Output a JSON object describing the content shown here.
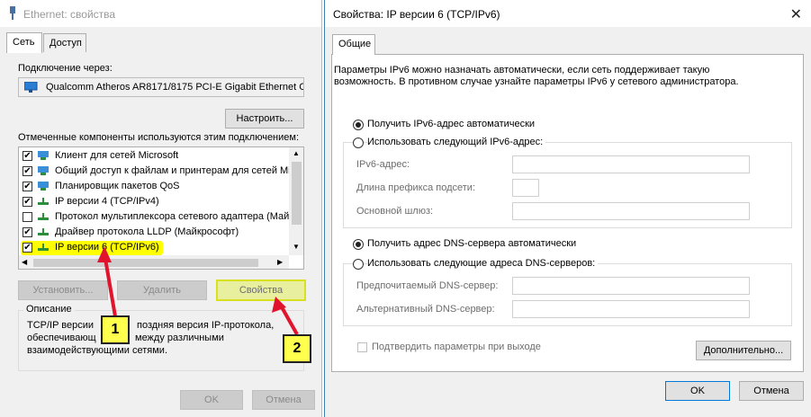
{
  "left_window": {
    "title": "Ethernet: свойства",
    "tabs": [
      "Сеть",
      "Доступ"
    ],
    "connect_using_label": "Подключение через:",
    "adapter_name": "Qualcomm Atheros AR8171/8175 PCI-E Gigabit Ethernet C",
    "configure_button": "Настроить...",
    "components_label": "Отмеченные компоненты используются этим подключением:",
    "components": [
      {
        "label": "Клиент для сетей Microsoft",
        "checked": true
      },
      {
        "label": "Общий доступ к файлам и принтерам для сетей Mi",
        "checked": true
      },
      {
        "label": "Планировщик пакетов QoS",
        "checked": true
      },
      {
        "label": "IP версии 4 (TCP/IPv4)",
        "checked": true
      },
      {
        "label": "Протокол мультиплексора сетевого адаптера (Май",
        "checked": false
      },
      {
        "label": "Драйвер протокола LLDP (Майкрософт)",
        "checked": true
      },
      {
        "label": "IP версии 6 (TCP/IPv6)",
        "checked": true
      }
    ],
    "install_button": "Установить...",
    "remove_button": "Удалить",
    "properties_button": "Свойства",
    "description_title": "Описание",
    "description_lines": [
      "TCP/IP версии",
      "обеспечивающ",
      "взаимодействующими сетями."
    ],
    "description_suffix_1": "поздняя версия IP-протокола,",
    "description_suffix_2": "между различными",
    "ok_button": "OK",
    "cancel_button": "Отмена",
    "highlight_color": "#ffff00"
  },
  "annotations": {
    "badge1": "1",
    "badge2": "2",
    "arrow_color": "#e0142c"
  },
  "right_window": {
    "title": "Свойства: IP версии 6 (TCP/IPv6)",
    "tab": "Общие",
    "intro_line1": "Параметры IPv6 можно назначать автоматически, если сеть поддерживает такую",
    "intro_line2": "возможность. В противном случае узнайте параметры IPv6 у сетевого администратора.",
    "auto_ip": "Получить IPv6-адрес автоматически",
    "manual_ip": "Использовать следующий IPv6-адрес:",
    "ipv6_address": "IPv6-адрес:",
    "prefix_length": "Длина префикса подсети:",
    "gateway": "Основной шлюз:",
    "auto_dns": "Получить адрес DNS-сервера автоматически",
    "manual_dns": "Использовать следующие адреса DNS-серверов:",
    "preferred_dns": "Предпочитаемый DNS-сервер:",
    "alternate_dns": "Альтернативный DNS-сервер:",
    "validate": "Подтвердить параметры при выходе",
    "advanced_button": "Дополнительно...",
    "ok_button": "OK",
    "cancel_button": "Отмена",
    "auto_ip_selected": true,
    "auto_dns_selected": true
  }
}
